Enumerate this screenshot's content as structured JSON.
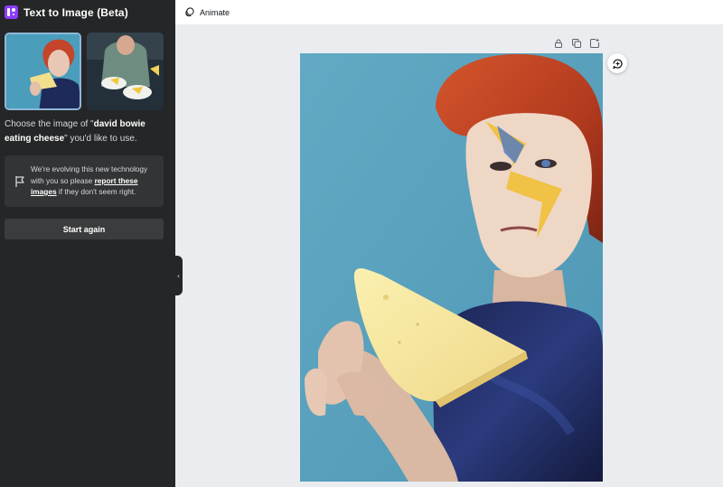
{
  "panel": {
    "title": "Text to Image (Beta)",
    "choose_prefix": "Choose the image of \"",
    "prompt": "david bowie eating cheese",
    "choose_suffix": "\" you'd like to use.",
    "notice_prefix": "We're evolving this new technology with you so please ",
    "notice_link": "report these images",
    "notice_suffix": " if they don't seem right.",
    "start_again": "Start again"
  },
  "topbar": {
    "animate_label": "Animate"
  },
  "icons": {
    "app": "text-to-image-app-icon",
    "flag": "flag-icon",
    "animate": "animate-icon",
    "lock": "lock-icon",
    "duplicate": "duplicate-icon",
    "add_page": "add-page-icon",
    "refresh": "refresh-comment-icon",
    "collapse": "chevron-left-icon"
  },
  "colors": {
    "panel_bg": "#252627",
    "accent": "#8b3dff",
    "canvas_bg": "#ebecf0",
    "image_bg": "#5aa2bd"
  }
}
